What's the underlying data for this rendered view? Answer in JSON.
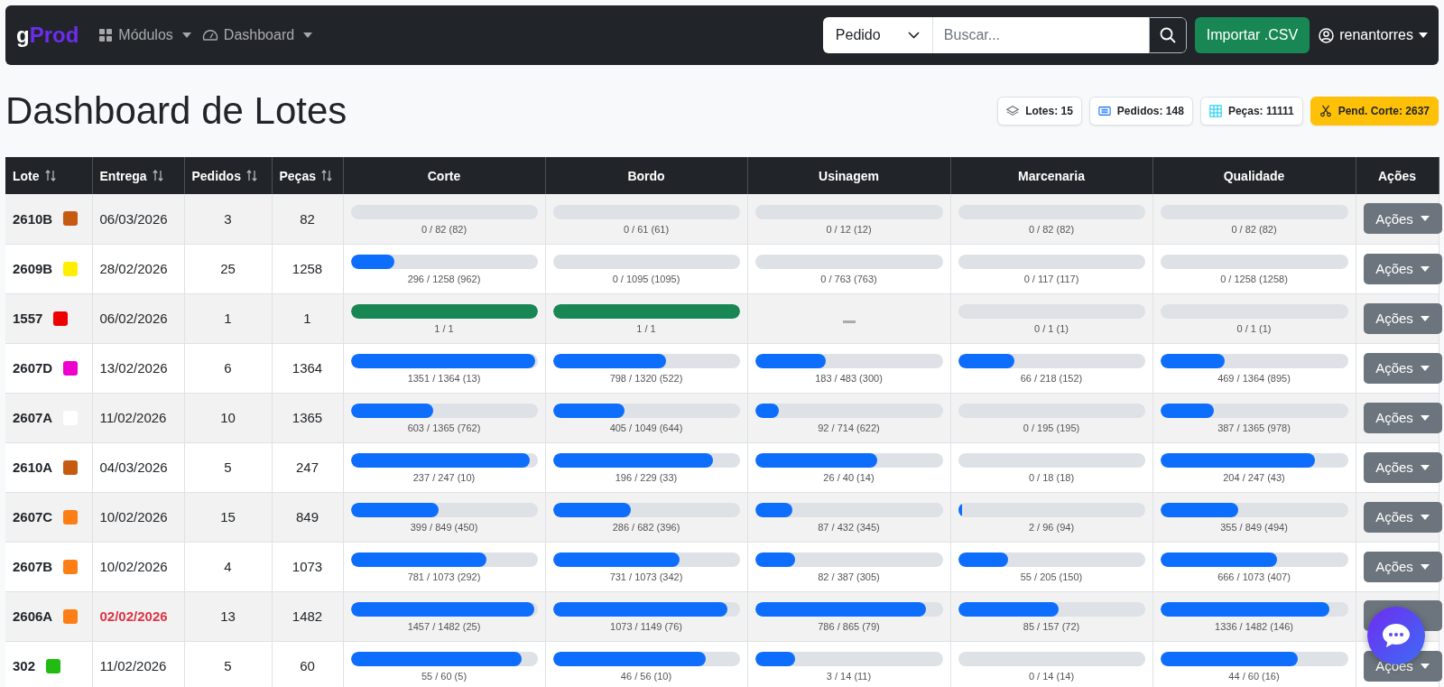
{
  "navbar": {
    "brand_first": "g",
    "brand_rest": "Prod",
    "menus": [
      "Módulos",
      "Dashboard"
    ],
    "search": {
      "scope": "Pedido",
      "placeholder": "Buscar..."
    },
    "import_button": "Importar .CSV",
    "user": "renantorres"
  },
  "title": "Dashboard de Lotes",
  "summary": [
    {
      "kind": "lotes",
      "label": "Lotes: 15"
    },
    {
      "kind": "pedidos",
      "label": "Pedidos: 148"
    },
    {
      "kind": "pecas",
      "label": "Peças: 11111"
    },
    {
      "kind": "pend",
      "label": "Pend. Corte: 2637"
    }
  ],
  "table": {
    "columns": [
      {
        "label": "Lote",
        "sortable": true
      },
      {
        "label": "Entrega",
        "sortable": true
      },
      {
        "label": "Pedidos",
        "sortable": true
      },
      {
        "label": "Peças",
        "sortable": true
      },
      {
        "label": "Corte",
        "sortable": false
      },
      {
        "label": "Bordo",
        "sortable": false
      },
      {
        "label": "Usinagem",
        "sortable": false
      },
      {
        "label": "Marcenaria",
        "sortable": false
      },
      {
        "label": "Qualidade",
        "sortable": false
      },
      {
        "label": "Ações",
        "sortable": false
      }
    ],
    "rows": [
      {
        "lote": "2610B",
        "color": "#c55a11",
        "entrega": "06/03/2026",
        "overdue": false,
        "pedidos": "3",
        "pecas": "82",
        "actions": "Ações",
        "stages": [
          {
            "kind": "progress",
            "level": 0,
            "label": "0 / 82 (82)"
          },
          {
            "kind": "progress",
            "level": 0,
            "label": "0 / 61 (61)"
          },
          {
            "kind": "progress",
            "level": 0,
            "label": "0 / 12 (12)"
          },
          {
            "kind": "progress",
            "level": 0,
            "label": "0 / 82 (82)"
          },
          {
            "kind": "progress",
            "level": 0,
            "label": "0 / 82 (82)"
          }
        ]
      },
      {
        "lote": "2609B",
        "color": "#ffee00",
        "entrega": "28/02/2026",
        "overdue": false,
        "pedidos": "25",
        "pecas": "1258",
        "actions": "Ações",
        "stages": [
          {
            "kind": "progress",
            "level": 0.235,
            "label": "296 / 1258 (962)"
          },
          {
            "kind": "progress",
            "level": 0,
            "label": "0 / 1095 (1095)"
          },
          {
            "kind": "progress",
            "level": 0,
            "label": "0 / 763 (763)"
          },
          {
            "kind": "progress",
            "level": 0,
            "label": "0 / 117 (117)"
          },
          {
            "kind": "progress",
            "level": 0,
            "label": "0 / 1258 (1258)"
          }
        ]
      },
      {
        "lote": "1557",
        "color": "#ee0000",
        "entrega": "06/02/2026",
        "overdue": false,
        "pedidos": "1",
        "pecas": "1",
        "actions": "Ações",
        "stages": [
          {
            "kind": "progress",
            "level": 1,
            "label": "1 / 1"
          },
          {
            "kind": "progress",
            "level": 1,
            "label": "1 / 1"
          },
          {
            "kind": "empty"
          },
          {
            "kind": "progress",
            "level": 0,
            "label": "0 / 1 (1)"
          },
          {
            "kind": "progress",
            "level": 0,
            "label": "0 / 1 (1)"
          }
        ]
      },
      {
        "lote": "2607D",
        "color": "#ee00cc",
        "entrega": "13/02/2026",
        "overdue": false,
        "pedidos": "6",
        "pecas": "1364",
        "actions": "Ações",
        "stages": [
          {
            "kind": "progress",
            "level": 0.99,
            "label": "1351 / 1364 (13)"
          },
          {
            "kind": "progress",
            "level": 0.605,
            "label": "798 / 1320 (522)"
          },
          {
            "kind": "progress",
            "level": 0.379,
            "label": "183 / 483 (300)"
          },
          {
            "kind": "progress",
            "level": 0.303,
            "label": "66 / 218 (152)"
          },
          {
            "kind": "progress",
            "level": 0.344,
            "label": "469 / 1364 (895)"
          }
        ]
      },
      {
        "lote": "2607A",
        "color": "#ffffff",
        "entrega": "11/02/2026",
        "overdue": false,
        "pedidos": "10",
        "pecas": "1365",
        "actions": "Ações",
        "stages": [
          {
            "kind": "progress",
            "level": 0.442,
            "label": "603 / 1365 (762)"
          },
          {
            "kind": "progress",
            "level": 0.386,
            "label": "405 / 1049 (644)"
          },
          {
            "kind": "progress",
            "level": 0.129,
            "label": "92 / 714 (622)"
          },
          {
            "kind": "progress",
            "level": 0,
            "label": "0 / 195 (195)"
          },
          {
            "kind": "progress",
            "level": 0.284,
            "label": "387 / 1365 (978)"
          }
        ]
      },
      {
        "lote": "2610A",
        "color": "#c55a11",
        "entrega": "04/03/2026",
        "overdue": false,
        "pedidos": "5",
        "pecas": "247",
        "actions": "Ações",
        "stages": [
          {
            "kind": "progress",
            "level": 0.96,
            "label": "237 / 247 (10)"
          },
          {
            "kind": "progress",
            "level": 0.856,
            "label": "196 / 229 (33)"
          },
          {
            "kind": "progress",
            "level": 0.65,
            "label": "26 / 40 (14)"
          },
          {
            "kind": "progress",
            "level": 0,
            "label": "0 / 18 (18)"
          },
          {
            "kind": "progress",
            "level": 0.826,
            "label": "204 / 247 (43)"
          }
        ]
      },
      {
        "lote": "2607C",
        "color": "#fd7e14",
        "entrega": "10/02/2026",
        "overdue": false,
        "pedidos": "15",
        "pecas": "849",
        "actions": "Ações",
        "stages": [
          {
            "kind": "progress",
            "level": 0.47,
            "label": "399 / 849 (450)"
          },
          {
            "kind": "progress",
            "level": 0.419,
            "label": "286 / 682 (396)"
          },
          {
            "kind": "progress",
            "level": 0.201,
            "label": "87 / 432 (345)"
          },
          {
            "kind": "progress",
            "level": 0.021,
            "label": "2 / 96 (94)"
          },
          {
            "kind": "progress",
            "level": 0.418,
            "label": "355 / 849 (494)"
          }
        ]
      },
      {
        "lote": "2607B",
        "color": "#fd7e14",
        "entrega": "10/02/2026",
        "overdue": false,
        "pedidos": "4",
        "pecas": "1073",
        "actions": "Ações",
        "stages": [
          {
            "kind": "progress",
            "level": 0.728,
            "label": "781 / 1073 (292)"
          },
          {
            "kind": "progress",
            "level": 0.681,
            "label": "731 / 1073 (342)"
          },
          {
            "kind": "progress",
            "level": 0.212,
            "label": "82 / 387 (305)"
          },
          {
            "kind": "progress",
            "level": 0.268,
            "label": "55 / 205 (150)"
          },
          {
            "kind": "progress",
            "level": 0.621,
            "label": "666 / 1073 (407)"
          }
        ]
      },
      {
        "lote": "2606A",
        "color": "#fd7e14",
        "entrega": "02/02/2026",
        "overdue": true,
        "pedidos": "13",
        "pecas": "1482",
        "stages": [
          {
            "kind": "progress",
            "level": 0.983,
            "label": "1457 / 1482 (25)"
          },
          {
            "kind": "progress",
            "level": 0.934,
            "label": "1073 / 1149 (76)"
          },
          {
            "kind": "progress",
            "level": 0.909,
            "label": "786 / 865 (79)"
          },
          {
            "kind": "progress",
            "level": 0.541,
            "label": "85 / 157 (72)"
          },
          {
            "kind": "progress",
            "level": 0.901,
            "label": "1336 / 1482 (146)"
          }
        ]
      },
      {
        "lote": "302",
        "color": "#22bb11",
        "entrega": "11/02/2026",
        "overdue": false,
        "pedidos": "5",
        "pecas": "60",
        "actions": "Ações",
        "stages": [
          {
            "kind": "progress",
            "level": 0.917,
            "label": "55 / 60 (5)"
          },
          {
            "kind": "progress",
            "level": 0.821,
            "label": "46 / 56 (10)"
          },
          {
            "kind": "progress",
            "level": 0.214,
            "label": "3 / 14 (11)"
          },
          {
            "kind": "progress",
            "level": 0,
            "label": "0 / 14 (14)"
          },
          {
            "kind": "progress",
            "level": 0.733,
            "label": "44 / 60 (16)"
          }
        ]
      }
    ]
  }
}
